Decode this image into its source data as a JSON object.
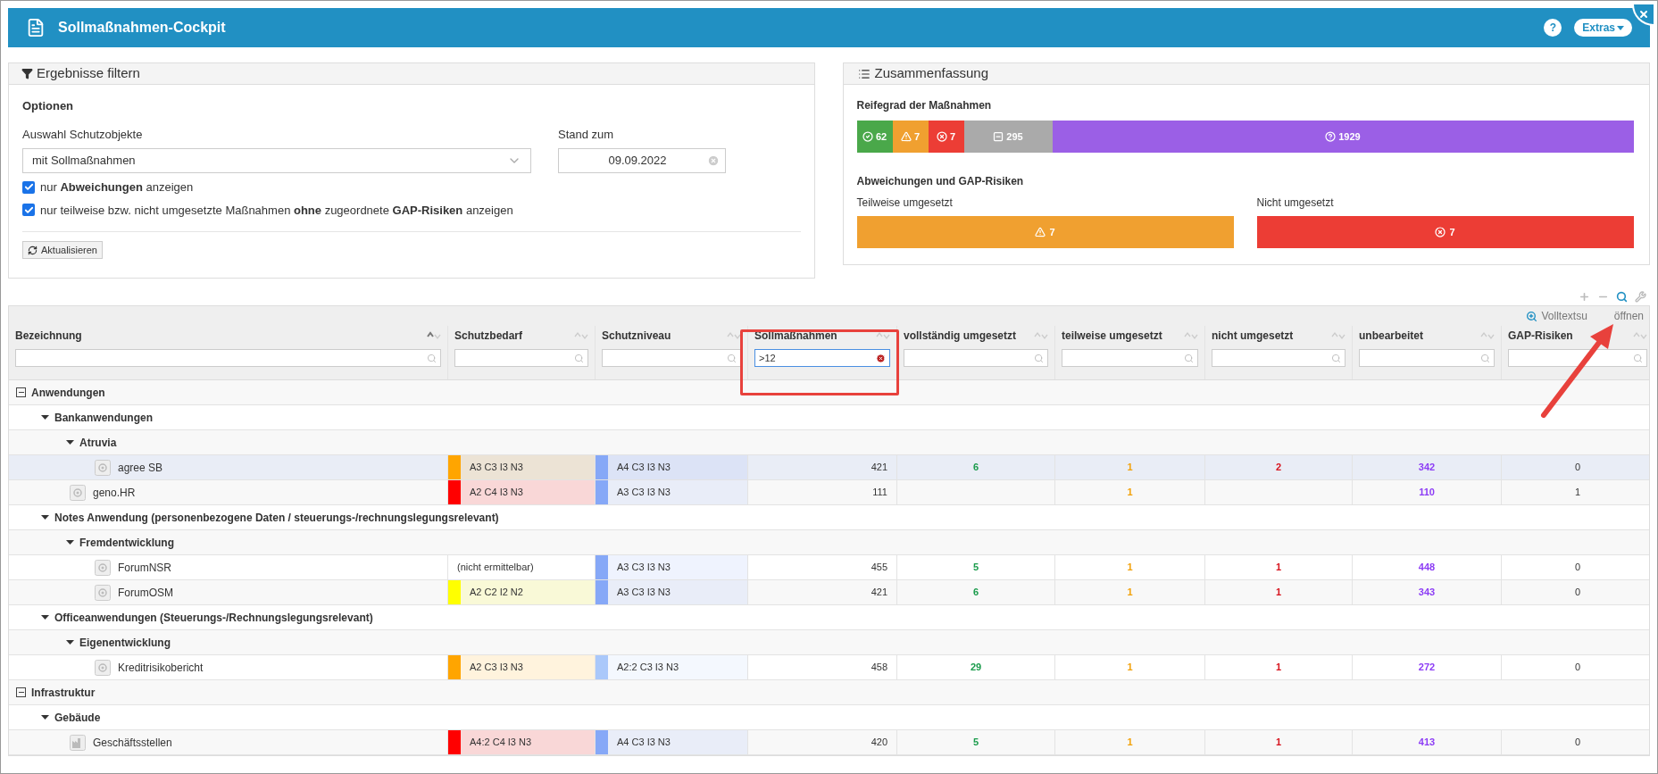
{
  "window": {
    "title": "Sollmaßnahmen-Cockpit",
    "help": "?",
    "extras": "Extras"
  },
  "filter_panel": {
    "title": "Ergebnisse filtern",
    "section": "Optionen",
    "select_label": "Auswahl Schutzobjekte",
    "select_value": "mit Sollmaßnahmen",
    "date_label": "Stand zum",
    "date_value": "09.09.2022",
    "checkboxes": [
      {
        "label": "nur **Abweichungen** anzeigen",
        "checked": true
      },
      {
        "label": "nur teilweise bzw. nicht umgesetzte Maßnahmen **ohne** zugeordnete **GAP-Risiken** anzeigen",
        "checked": true
      }
    ],
    "button": "Aktualisieren"
  },
  "summary_panel": {
    "title": "Zusammenfassung",
    "maturity_title": "Reifegrad der Maßnahmen",
    "segments": [
      {
        "kind": "ok",
        "value": "62"
      },
      {
        "kind": "warn",
        "value": "7"
      },
      {
        "kind": "error",
        "value": "7"
      },
      {
        "kind": "neutral",
        "value": "295"
      },
      {
        "kind": "unknown",
        "value": "1929"
      }
    ],
    "gap_title": "Abweichungen und GAP-Risiken",
    "gap_boxes": [
      {
        "kind": "warn",
        "label": "Teilweise umgesetzt",
        "value": "7"
      },
      {
        "kind": "error",
        "label": "Nicht umgesetzt",
        "value": "7"
      }
    ]
  },
  "table": {
    "fulltext_link": [
      "Volltextsu",
      "öffnen"
    ],
    "columns": [
      {
        "label": "Bezeichnung",
        "sorted": true
      },
      {
        "label": "Schutzbedarf",
        "sorted": false
      },
      {
        "label": "Schutzniveau",
        "sorted": false
      },
      {
        "label": "Sollmaßnahmen",
        "sorted": false,
        "filter": ">12"
      },
      {
        "label": "vollständig umgesetzt",
        "sorted": false,
        "color": "#1a9b4b"
      },
      {
        "label": "teilweise umgesetzt",
        "sorted": false,
        "color": "#f2a20c"
      },
      {
        "label": "nicht umgesetzt",
        "sorted": false,
        "color": "#d7141e"
      },
      {
        "label": "unbearbeitet",
        "sorted": false,
        "color": "#8c3cf5"
      },
      {
        "label": "GAP-Risiken",
        "sorted": false
      }
    ],
    "tree": [
      {
        "kind": "category",
        "label": "Anwendungen",
        "expanded": true,
        "children": [
          {
            "kind": "group",
            "label": "Bankanwendungen",
            "expanded": true,
            "children": [
              {
                "kind": "group",
                "label": "Atruvia",
                "expanded": true,
                "children": [
                  {
                    "kind": "object",
                    "label": "agree SB",
                    "selected": true,
                    "need": {
                      "text": "A3 C3 I3 N3",
                      "color": "#ffa500"
                    },
                    "level_cell": {
                      "text": "A4 C3 I3 N3",
                      "color": "#86a8f7"
                    },
                    "values": {
                      "sollmassnahmen": "421",
                      "vollstaendig": "6",
                      "teilweise": "1",
                      "nicht": "2",
                      "unbearbeitet": "342",
                      "gap_risiken": "0"
                    }
                  }
                ]
              },
              {
                "kind": "object",
                "label": "geno.HR",
                "selected": false,
                "need": {
                  "text": "A2 C4 I3 N3",
                  "color": "#ff0000"
                },
                "level_cell": {
                  "text": "A3 C3 I3 N3",
                  "color": "#86a8f7"
                },
                "values": {
                  "sollmassnahmen": "111",
                  "teilweise": "1",
                  "unbearbeitet": "110",
                  "gap_risiken": "1"
                }
              }
            ]
          },
          {
            "kind": "group",
            "label": "Notes Anwendung (personenbezogene Daten / steuerungs-/rechnungslegungsrelevant)",
            "expanded": true,
            "children": [
              {
                "kind": "group",
                "label": "Fremdentwicklung",
                "expanded": true,
                "children": [
                  {
                    "kind": "object",
                    "label": "ForumNSR",
                    "selected": false,
                    "need": {
                      "text": "(nicht ermittelbar)"
                    },
                    "level_cell": {
                      "text": "A3 C3 I3 N3",
                      "color": "#86a8f7"
                    },
                    "values": {
                      "sollmassnahmen": "455",
                      "vollstaendig": "5",
                      "teilweise": "1",
                      "nicht": "1",
                      "unbearbeitet": "448",
                      "gap_risiken": "0"
                    }
                  },
                  {
                    "kind": "object",
                    "label": "ForumOSM",
                    "selected": false,
                    "need": {
                      "text": "A2 C2 I2 N2",
                      "color": "#ffff00"
                    },
                    "level_cell": {
                      "text": "A3 C3 I3 N3",
                      "color": "#86a8f7"
                    },
                    "values": {
                      "sollmassnahmen": "421",
                      "vollstaendig": "6",
                      "teilweise": "1",
                      "nicht": "1",
                      "unbearbeitet": "343",
                      "gap_risiken": "0"
                    }
                  }
                ]
              }
            ]
          },
          {
            "kind": "group",
            "label": "Officeanwendungen (Steuerungs-/Rechnungslegungsrelevant)",
            "expanded": true,
            "children": [
              {
                "kind": "group",
                "label": "Eigenentwicklung",
                "expanded": true,
                "children": [
                  {
                    "kind": "object",
                    "label": "Kreditrisikobericht",
                    "selected": false,
                    "need": {
                      "text": "A2 C3 I3 N3",
                      "color": "#ffa500"
                    },
                    "level_cell": {
                      "text": "A2:2 C3 I3 N3",
                      "color": "#aac8fa"
                    },
                    "values": {
                      "sollmassnahmen": "458",
                      "vollstaendig": "29",
                      "teilweise": "1",
                      "nicht": "1",
                      "unbearbeitet": "272",
                      "gap_risiken": "0"
                    }
                  }
                ]
              }
            ]
          }
        ]
      },
      {
        "kind": "category",
        "label": "Infrastruktur",
        "expanded": true,
        "children": [
          {
            "kind": "group",
            "label": "Gebäude",
            "expanded": true,
            "children": [
              {
                "kind": "building",
                "label": "Geschäftsstellen",
                "selected": false,
                "need": {
                  "text": "A4:2 C4 I3 N3",
                  "color": "#ff0000"
                },
                "level_cell": {
                  "text": "A4 C3 I3 N3",
                  "color": "#86a8f7"
                },
                "values": {
                  "sollmassnahmen": "420",
                  "vollstaendig": "5",
                  "teilweise": "1",
                  "nicht": "1",
                  "unbearbeitet": "413",
                  "gap_risiken": "0"
                }
              }
            ]
          }
        ]
      }
    ]
  }
}
